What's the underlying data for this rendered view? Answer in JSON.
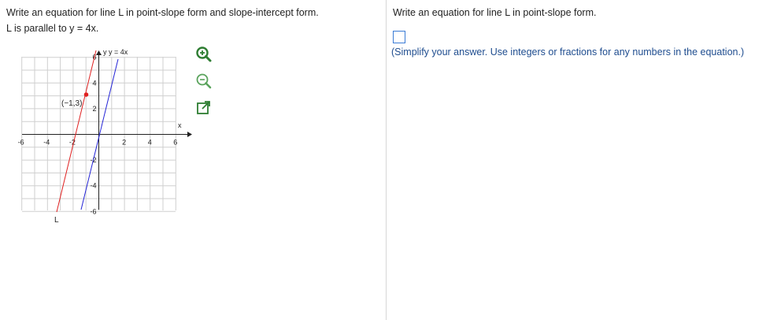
{
  "question": {
    "line1": "Write an equation for line L in point-slope form and slope-intercept form.",
    "line2": "L is parallel to y = 4x."
  },
  "graph": {
    "x_ticks": [
      "-6",
      "-4",
      "-2",
      "2",
      "4",
      "6"
    ],
    "y_ticks": [
      "6",
      "4",
      "2",
      "-2",
      "-4",
      "-6"
    ],
    "x_axis_label": "x",
    "y_axis_label": "y",
    "blue_line_label": "y = 4x",
    "point_label": "(−1,3)",
    "line_L_label": "L",
    "colors": {
      "blue_line": "#2424d6",
      "red_line": "#e02020",
      "grid": "#cfcfcf",
      "axis": "#222222"
    }
  },
  "tools": [
    "zoom-in-icon",
    "zoom-out-icon",
    "open-new-window-icon"
  ],
  "right_panel": {
    "prompt": "Write an equation for line L in point-slope form.",
    "hint": "(Simplify your answer. Use integers or fractions for any numbers in the equation.)"
  }
}
